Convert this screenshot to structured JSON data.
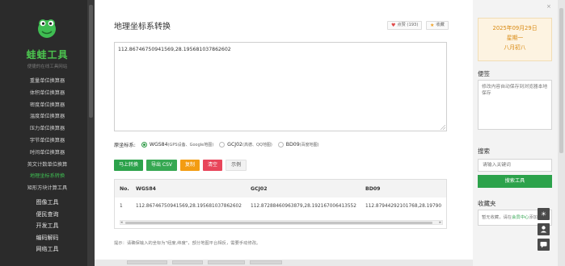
{
  "sidebar": {
    "brand": "蛙蛙工具",
    "slogan": "便捷的在线工具网站",
    "items": [
      {
        "label": "重量单位换算器"
      },
      {
        "label": "体积单位换算器"
      },
      {
        "label": "密度单位换算器"
      },
      {
        "label": "温度单位换算器"
      },
      {
        "label": "压力单位换算器"
      },
      {
        "label": "字节单位换算器"
      },
      {
        "label": "时间单位换算器"
      },
      {
        "label": "英文计数单位换算"
      },
      {
        "label": "地理坐标系转换"
      },
      {
        "label": "矩形方块计算工具"
      }
    ],
    "active_index": 8,
    "groups": [
      {
        "label": "图像工具"
      },
      {
        "label": "便民查询"
      },
      {
        "label": "开发工具"
      },
      {
        "label": "编码解码"
      },
      {
        "label": "网络工具"
      }
    ]
  },
  "main": {
    "title": "地理坐标系转换",
    "like_label": "点赞 (193)",
    "fav_label": "收藏",
    "input_value": "112.86746750941569,28.195681037862602",
    "crs_label": "原坐标系:",
    "crs_options": [
      {
        "name": "WGS84",
        "detail": "(GPS设备、Google地图)",
        "selected": true
      },
      {
        "name": "GCJ02",
        "detail": "(高德、QQ地图)",
        "selected": false
      },
      {
        "name": "BD09",
        "detail": "(百度地图)",
        "selected": false
      }
    ],
    "buttons": {
      "convert": "马上转换",
      "export_csv": "导出 CSV",
      "copy": "复制",
      "clear": "清空",
      "example": "示例"
    },
    "table": {
      "headers": [
        "No.",
        "WGS84",
        "GCJ02",
        "BD09"
      ],
      "rows": [
        [
          "1",
          "112.86746750941569,28.195681037862602",
          "112.87288460963879,28.192167006413552",
          "112.87944292101768,28.19790"
        ]
      ]
    },
    "hint": "提示：请确保输入的坐标为\"经度,纬度\"，部分地图平台相反，需要手动修改。"
  },
  "right": {
    "date": "2025年09月29日",
    "weekday": "星期一",
    "lunar": "八月初八",
    "memo_title": "便签",
    "memo_text": "修改内容自动保存到浏览器本地保存",
    "search_title": "搜索",
    "search_placeholder": "请输入关键词",
    "search_button": "搜索工具",
    "fav_title": "收藏夹",
    "fav_prefix": "暂无收藏，请在",
    "fav_link": "会员中心",
    "fav_suffix": "添加"
  },
  "colors": {
    "brand_green": "#4cc44f",
    "button_green": "#2ca24b",
    "sidebar_bg": "#2b2b2b",
    "date_text": "#d98a12"
  }
}
